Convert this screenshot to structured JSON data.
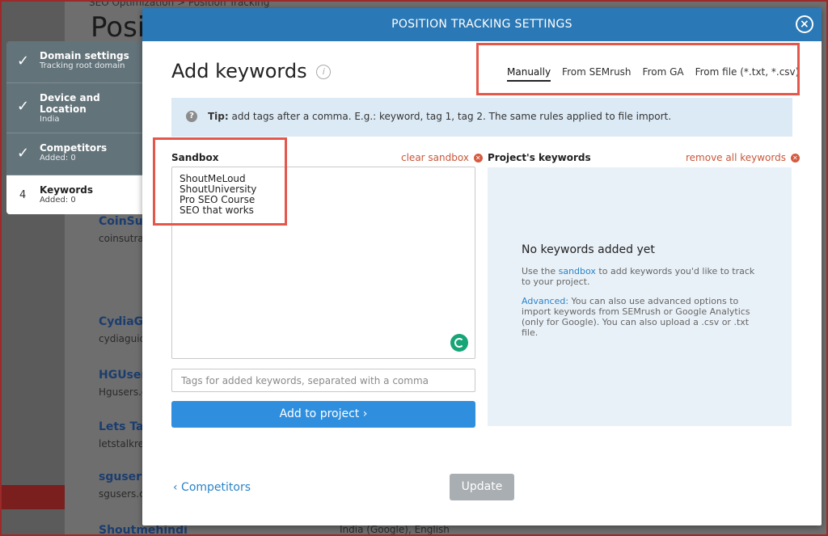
{
  "background": {
    "breadcrumb": "SEO Optimization  >  Position Tracking",
    "title": "Posi",
    "sites": [
      {
        "name": "CoinSut",
        "url": "coinsutra"
      },
      {
        "name": "CydiaGu",
        "url": "cydiaguid"
      },
      {
        "name": "HGUser",
        "url": "Hgusers.c"
      },
      {
        "name": "Lets Tal",
        "url": "letstalkre"
      },
      {
        "name": "sgusers",
        "url": "sgusers.c"
      },
      {
        "name": "Shoutmehindi",
        "url": ""
      }
    ],
    "bottom_row": "India (Google), English"
  },
  "steps": [
    {
      "title": "Domain settings",
      "sub": "Tracking root domain",
      "done": true
    },
    {
      "title": "Device and Location",
      "sub": "India",
      "done": true
    },
    {
      "title": "Competitors",
      "sub": "Added: 0",
      "done": true
    },
    {
      "number": "4",
      "title": "Keywords",
      "sub": "Added: 0",
      "done": false
    }
  ],
  "modal": {
    "header": "POSITION TRACKING SETTINGS",
    "close_icon": "×",
    "heading": "Add keywords",
    "info_icon": "i",
    "tabs": [
      "Manually",
      "From SEMrush",
      "From GA",
      "From file (*.txt, *.csv)"
    ],
    "tip_icon": "?",
    "tip_bold": "Tip:",
    "tip_text": " add tags after a comma. E.g.: keyword, tag 1, tag 2. The same rules applied to file import.",
    "sandbox_label": "Sandbox",
    "clear_sandbox": "clear sandbox",
    "sandbox_keywords": [
      "ShoutMeLoud",
      "ShoutUniversity",
      "Pro SEO Course",
      "SEO that works"
    ],
    "tags_placeholder": "Tags for added keywords, separated with a comma",
    "add_button": "Add to project ›",
    "project_keywords_label": "Project's keywords",
    "remove_all": "remove all keywords",
    "empty_title": "No keywords added yet",
    "empty_text_1_pre": "Use the ",
    "empty_text_1_link": "sandbox",
    "empty_text_1_post": " to add keywords you'd like to track to your project.",
    "empty_text_2_link": "Advanced:",
    "empty_text_2_post": " You can also use advanced options to import keywords from SEMrush or Google Analytics (only for Google). You can also upload a .csv or .txt file.",
    "back_link": "‹  Competitors",
    "update_button": "Update"
  },
  "colors": {
    "header_blue": "#2a78b5",
    "primary_button": "#2f8fde",
    "highlight_red": "#e4574b",
    "link": "#2a83c8",
    "danger_link": "#c8573a"
  }
}
